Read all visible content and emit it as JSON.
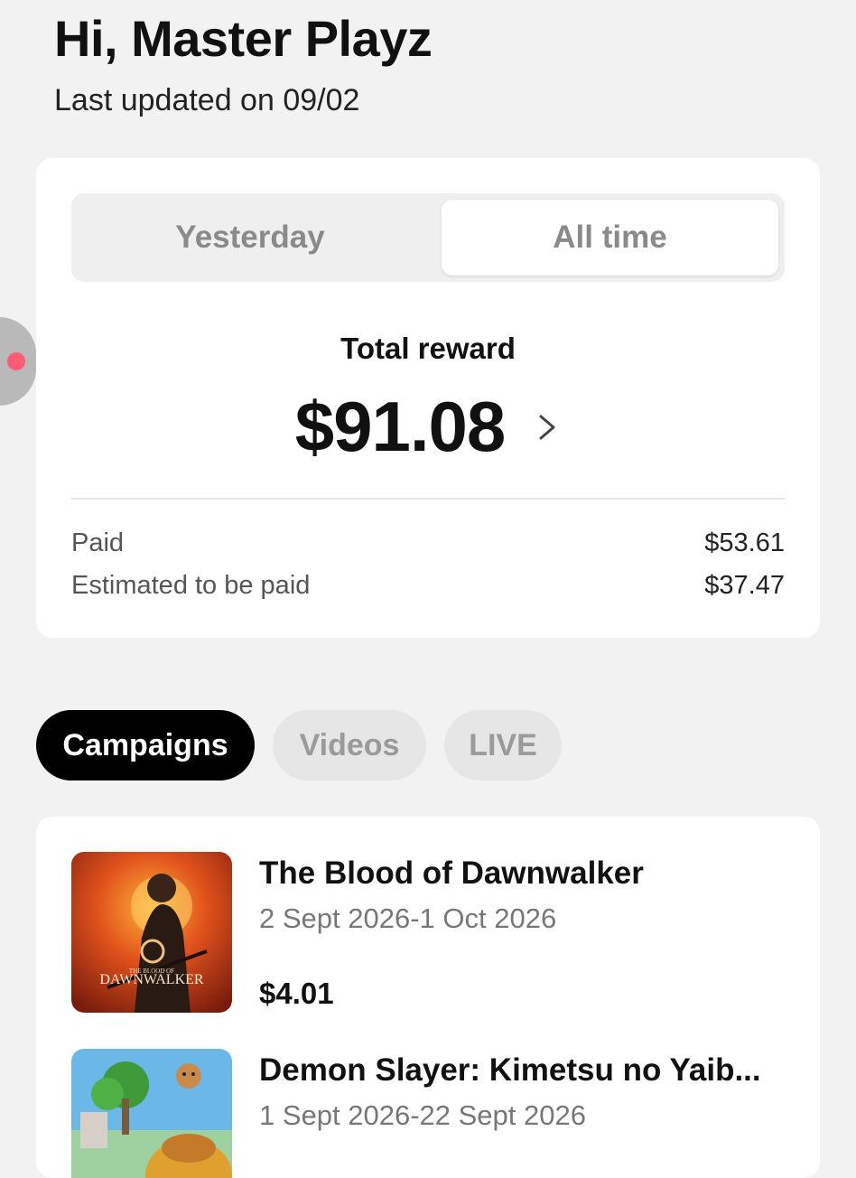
{
  "header": {
    "greeting": "Hi, Master Playz",
    "updated": "Last updated on 09/02"
  },
  "summary": {
    "tabs": [
      {
        "label": "Yesterday",
        "selected": false
      },
      {
        "label": "All time",
        "selected": true
      }
    ],
    "total_label": "Total reward",
    "total_amount": "$91.08",
    "breakdown": [
      {
        "label": "Paid",
        "value": "$53.61"
      },
      {
        "label": "Estimated to be paid",
        "value": "$37.47"
      }
    ]
  },
  "filters": [
    {
      "label": "Campaigns",
      "active": true
    },
    {
      "label": "Videos",
      "active": false
    },
    {
      "label": "LIVE",
      "active": false
    }
  ],
  "campaigns": [
    {
      "title": "The Blood of Dawnwalker",
      "dates": "2 Sept 2026-1 Oct 2026",
      "amount": "$4.01",
      "thumb_text": "DAWNWALKER",
      "thumb_small": "THE BLOOD OF"
    },
    {
      "title": "Demon Slayer: Kimetsu no Yaib...",
      "dates": "1 Sept 2026-22 Sept 2026",
      "amount": ""
    }
  ],
  "colors": {
    "background": "#f2f2f2",
    "card": "#ffffff",
    "active_chip": "#000000",
    "inactive_chip": "#e6e6e6",
    "accent_dot": "#ff5c73"
  }
}
